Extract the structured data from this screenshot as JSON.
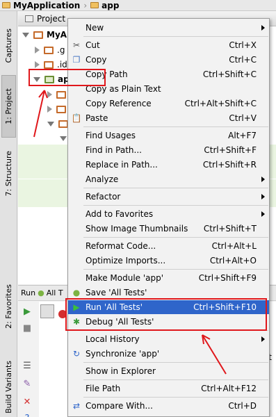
{
  "breadcrumb": {
    "project": "MyApplication",
    "module": "app"
  },
  "strip": {
    "tabs": [
      {
        "label": "Captures"
      },
      {
        "label": "1: Project"
      },
      {
        "label": "7: Structure"
      },
      {
        "label": "2: Favorites"
      },
      {
        "label": "Build Variants"
      }
    ]
  },
  "panel": {
    "header": "Project",
    "tree": [
      {
        "label": "MyAp"
      },
      {
        "label": ".g"
      },
      {
        "label": ".id"
      },
      {
        "label": "ap"
      }
    ]
  },
  "run": {
    "label": "Run",
    "tab": "All T",
    "stub": "st"
  },
  "menu": {
    "items": [
      {
        "label": "New",
        "shortcut": ""
      },
      {
        "label": "Cut",
        "shortcut": "Ctrl+X"
      },
      {
        "label": "Copy",
        "shortcut": "Ctrl+C"
      },
      {
        "label": "Copy Path",
        "shortcut": "Ctrl+Shift+C"
      },
      {
        "label": "Copy as Plain Text",
        "shortcut": ""
      },
      {
        "label": "Copy Reference",
        "shortcut": "Ctrl+Alt+Shift+C"
      },
      {
        "label": "Paste",
        "shortcut": "Ctrl+V"
      },
      {
        "label": "Find Usages",
        "shortcut": "Alt+F7"
      },
      {
        "label": "Find in Path...",
        "shortcut": "Ctrl+Shift+F"
      },
      {
        "label": "Replace in Path...",
        "shortcut": "Ctrl+Shift+R"
      },
      {
        "label": "Analyze",
        "shortcut": ""
      },
      {
        "label": "Refactor",
        "shortcut": ""
      },
      {
        "label": "Add to Favorites",
        "shortcut": ""
      },
      {
        "label": "Show Image Thumbnails",
        "shortcut": "Ctrl+Shift+T"
      },
      {
        "label": "Reformat Code...",
        "shortcut": "Ctrl+Alt+L"
      },
      {
        "label": "Optimize Imports...",
        "shortcut": "Ctrl+Alt+O"
      },
      {
        "label": "Make Module 'app'",
        "shortcut": "Ctrl+Shift+F9"
      },
      {
        "label": "Save 'All Tests'",
        "shortcut": ""
      },
      {
        "label": "Run 'All Tests'",
        "shortcut": "Ctrl+Shift+F10"
      },
      {
        "label": "Debug 'All Tests'",
        "shortcut": ""
      },
      {
        "label": "Local History",
        "shortcut": ""
      },
      {
        "label": "Synchronize 'app'",
        "shortcut": ""
      },
      {
        "label": "Show in Explorer",
        "shortcut": ""
      },
      {
        "label": "File Path",
        "shortcut": "Ctrl+Alt+F12"
      },
      {
        "label": "Compare With...",
        "shortcut": "Ctrl+D"
      }
    ]
  },
  "colors": {
    "selection": "#2f65ca",
    "annotation": "#e0171b",
    "run_green": "#3a9a3a"
  }
}
